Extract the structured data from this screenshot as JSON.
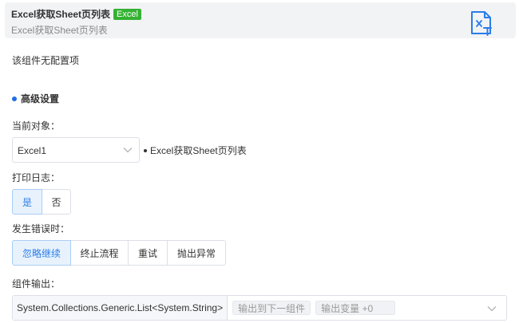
{
  "header": {
    "title": "Excel获取Sheet页列表",
    "badge": "Excel",
    "subtitle": "Excel获取Sheet页列表",
    "icon": "excel-file-icon"
  },
  "no_config": "该组件无配置项",
  "advanced": {
    "title": "高级设置"
  },
  "current_object": {
    "label": "当前对象：",
    "selected": "Excel1",
    "description": "Excel获取Sheet页列表"
  },
  "print_log": {
    "label": "打印日志：",
    "options": [
      "是",
      "否"
    ],
    "selected": "是"
  },
  "on_error": {
    "label": "发生错误时：",
    "options": [
      "忽略继续",
      "终止流程",
      "重试",
      "抛出异常"
    ],
    "selected": "忽略继续"
  },
  "output": {
    "label": "组件输出：",
    "type": "System.Collections.Generic.List<System.String>",
    "tag_next": "输出到下一组件",
    "tag_var": "输出变量 +0"
  },
  "colors": {
    "accent": "#2b7de9",
    "badge": "#34b233",
    "header_bg": "#f2f3f5"
  }
}
